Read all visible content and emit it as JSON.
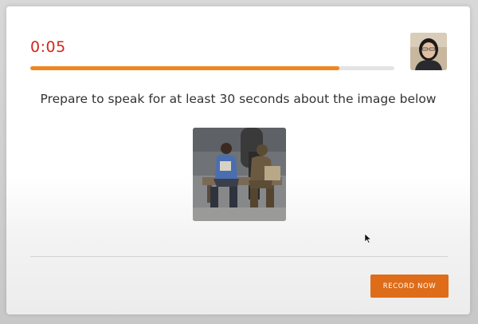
{
  "timer": {
    "text": "0:05"
  },
  "progress": {
    "fraction": 0.85,
    "fill_color": "#f0861f",
    "track_color": "#e4e4e4"
  },
  "webcam": {
    "icon": "webcam-feed"
  },
  "prompt": {
    "text": "Prepare to speak for at least 30 seconds about the image below"
  },
  "photo": {
    "icon": "statue-bench-photo"
  },
  "record_button": {
    "label": "RECORD NOW",
    "color": "#de6c18"
  },
  "colors": {
    "timer": "#d0271d",
    "accent": "#f0861f"
  }
}
